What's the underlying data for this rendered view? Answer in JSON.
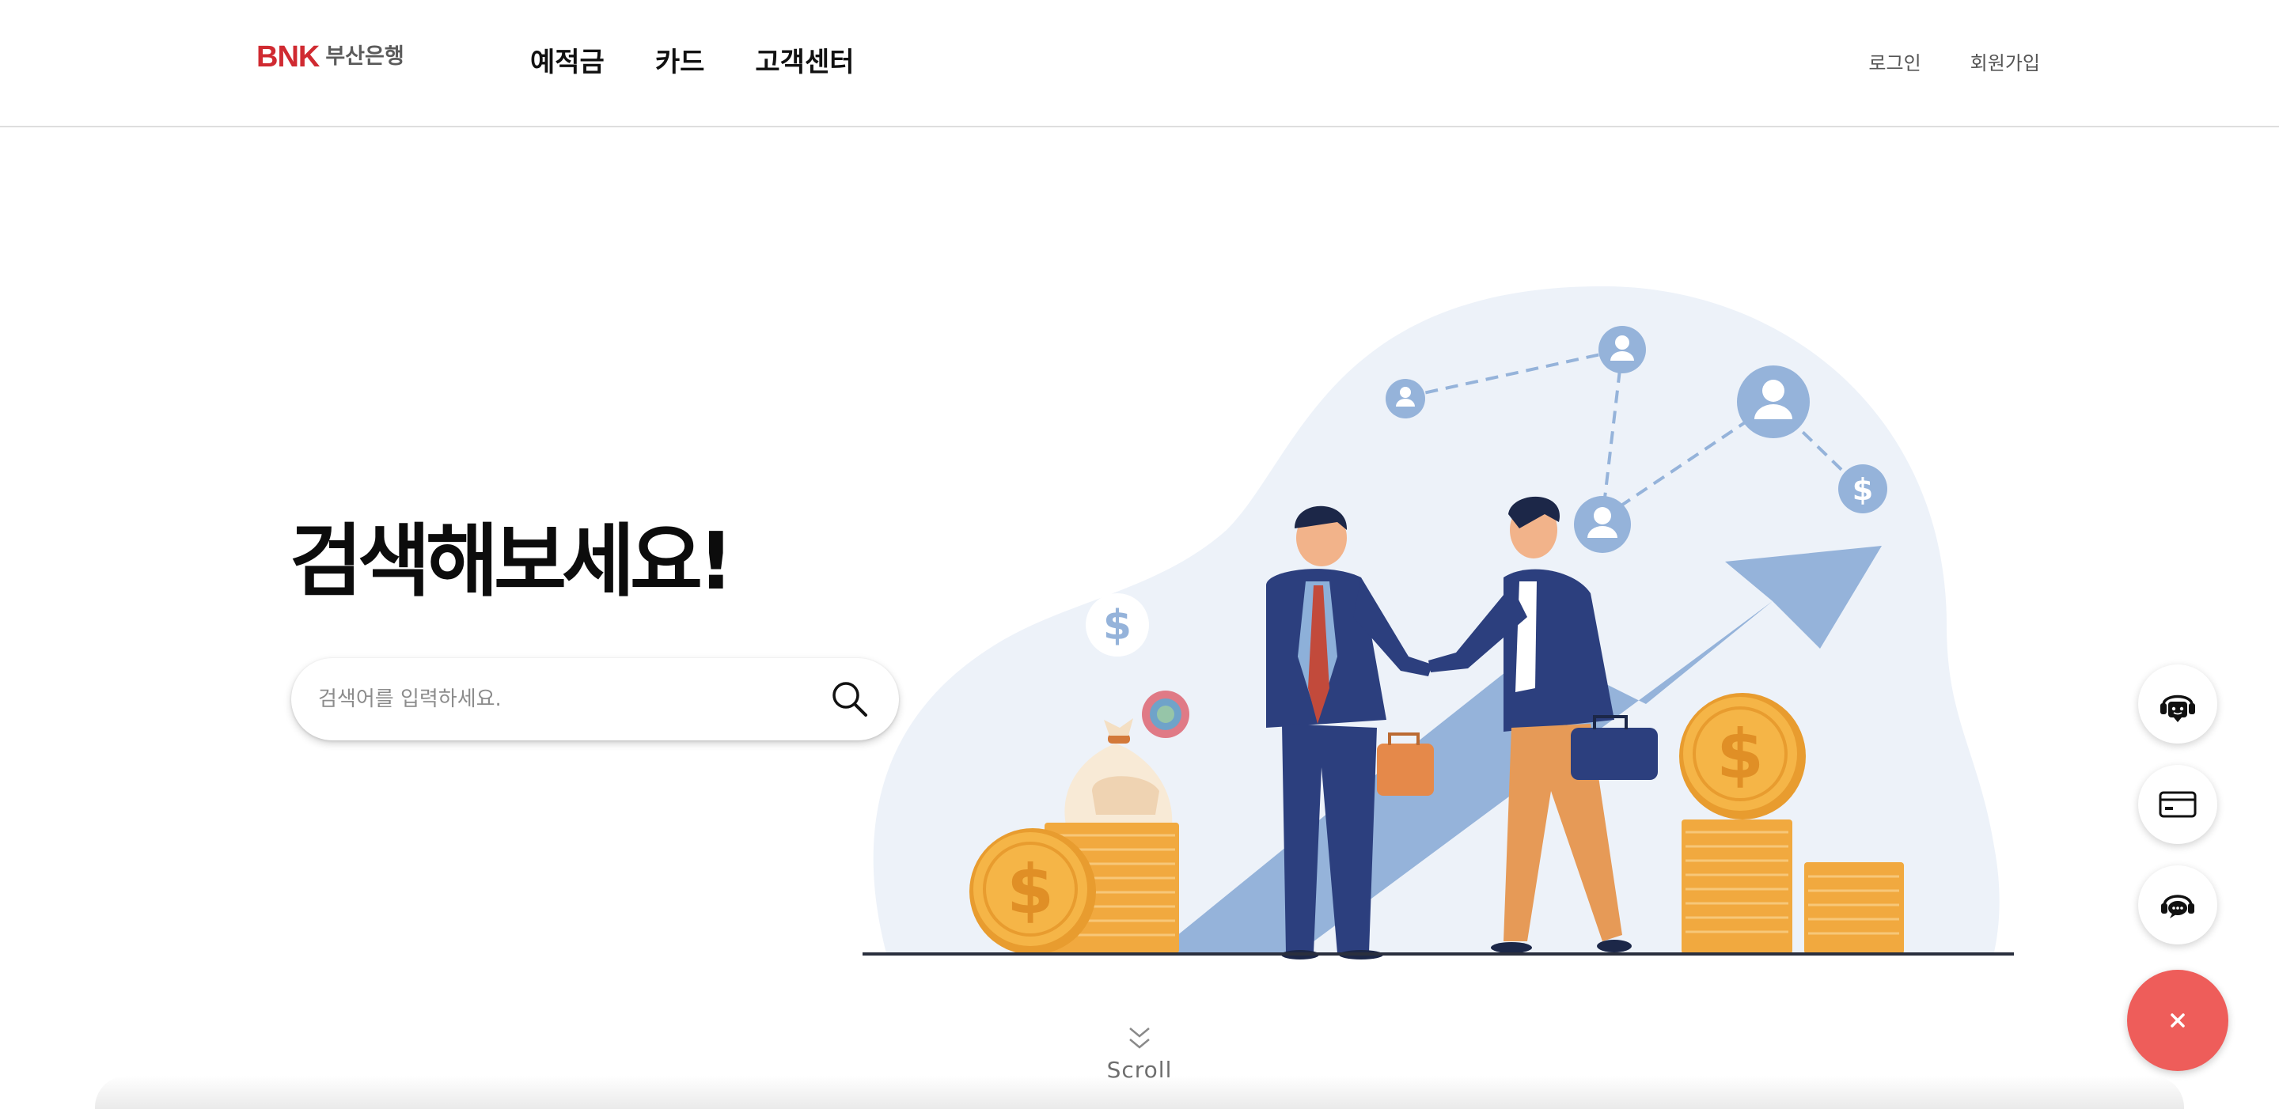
{
  "header": {
    "logo_mark": "BNK",
    "logo_text": "부산은행",
    "nav": [
      {
        "label": "예적금"
      },
      {
        "label": "카드"
      },
      {
        "label": "고객센터"
      }
    ],
    "util": {
      "login": "로그인",
      "signup": "회원가입"
    }
  },
  "hero": {
    "title": "검색해보세요!",
    "search": {
      "placeholder": "검색어를 입력하세요.",
      "value": ""
    }
  },
  "scroll": {
    "label": "Scroll"
  },
  "quick_menu": {
    "items": [
      {
        "icon": "chatbot-icon"
      },
      {
        "icon": "card-icon"
      },
      {
        "icon": "headset-chat-icon"
      }
    ],
    "close_icon": "close-icon"
  },
  "colors": {
    "brand_red": "#d02a31",
    "fab_red": "#ee5d5a",
    "blob": "#edf2f9",
    "arrow": "#95b3da",
    "navy": "#2c3f7e",
    "coin": "#f1a93f"
  },
  "illustration": {
    "coin_symbol": "$"
  }
}
